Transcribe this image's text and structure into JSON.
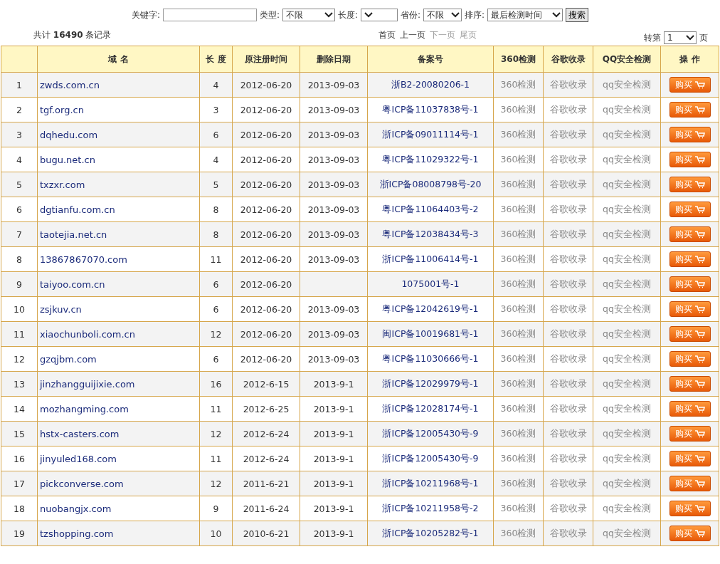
{
  "filters": {
    "keyword_label": "关键字:",
    "type_label": "类型:",
    "type_value": "不限",
    "length_label": "长度:",
    "province_label": "省份:",
    "province_value": "不限",
    "sort_label": "排序:",
    "sort_value": "最后检测时间",
    "search_button": "搜索"
  },
  "summary": {
    "prefix": "共计",
    "count": "16490",
    "suffix": "条记录"
  },
  "pager": [
    {
      "label": "首页",
      "disabled": false
    },
    {
      "label": "上一页",
      "disabled": false
    },
    {
      "label": "下一页",
      "disabled": true
    },
    {
      "label": "尾页",
      "disabled": true
    }
  ],
  "jump": {
    "prefix": "转第",
    "value": "1",
    "suffix": "页"
  },
  "table": {
    "columns": [
      "",
      "域 名",
      "长 度",
      "原注册时间",
      "删除日期",
      "备案号",
      "360检测",
      "谷歌收录",
      "QQ安全检测",
      "操 作"
    ],
    "rows": [
      {
        "no": "1",
        "domain": "zwds.com.cn",
        "length": "4",
        "registered": "2012-06-20",
        "deleted": "2013-09-03",
        "icp": "浙B2-20080206-1",
        "check360": "360检测",
        "google": "谷歌收录",
        "qq": "qq安全检测",
        "buy": "购买"
      },
      {
        "no": "2",
        "domain": "tgf.org.cn",
        "length": "3",
        "registered": "2012-06-20",
        "deleted": "2013-09-03",
        "icp": "粤ICP备11037838号-1",
        "check360": "360检测",
        "google": "谷歌收录",
        "qq": "qq安全检测",
        "buy": "购买"
      },
      {
        "no": "3",
        "domain": "dqhedu.com",
        "length": "6",
        "registered": "2012-06-20",
        "deleted": "2013-09-03",
        "icp": "浙ICP备09011114号-1",
        "check360": "360检测",
        "google": "谷歌收录",
        "qq": "qq安全检测",
        "buy": "购买"
      },
      {
        "no": "4",
        "domain": "bugu.net.cn",
        "length": "4",
        "registered": "2012-06-20",
        "deleted": "2013-09-03",
        "icp": "粤ICP备11029322号-1",
        "check360": "360检测",
        "google": "谷歌收录",
        "qq": "qq安全检测",
        "buy": "购买"
      },
      {
        "no": "5",
        "domain": "txzxr.com",
        "length": "5",
        "registered": "2012-06-20",
        "deleted": "2013-09-03",
        "icp": "浙ICP备08008798号-20",
        "check360": "360检测",
        "google": "谷歌收录",
        "qq": "qq安全检测",
        "buy": "购买"
      },
      {
        "no": "6",
        "domain": "dgtianfu.com.cn",
        "length": "8",
        "registered": "2012-06-20",
        "deleted": "2013-09-03",
        "icp": "粤ICP备11064403号-2",
        "check360": "360检测",
        "google": "谷歌收录",
        "qq": "qq安全检测",
        "buy": "购买"
      },
      {
        "no": "7",
        "domain": "taotejia.net.cn",
        "length": "8",
        "registered": "2012-06-20",
        "deleted": "2013-09-03",
        "icp": "粤ICP备12038434号-3",
        "check360": "360检测",
        "google": "谷歌收录",
        "qq": "qq安全检测",
        "buy": "购买"
      },
      {
        "no": "8",
        "domain": "13867867070.com",
        "length": "11",
        "registered": "2012-06-20",
        "deleted": "2013-09-03",
        "icp": "浙ICP备11006414号-1",
        "check360": "360检测",
        "google": "谷歌收录",
        "qq": "qq安全检测",
        "buy": "购买"
      },
      {
        "no": "9",
        "domain": "taiyoo.com.cn",
        "length": "6",
        "registered": "2012-06-20",
        "icp": "1075001号-1",
        "check360": "360检测",
        "google": "谷歌收录",
        "qq": "qq安全检测",
        "buy": "购买"
      },
      {
        "no": "10",
        "domain": "zsjkuv.cn",
        "length": "6",
        "registered": "2012-06-20",
        "deleted": "2013-09-03",
        "icp": "粤ICP备12042619号-1",
        "check360": "360检测",
        "google": "谷歌收录",
        "qq": "qq安全检测",
        "buy": "购买"
      },
      {
        "no": "11",
        "domain": "xiaochunboli.com.cn",
        "length": "12",
        "registered": "2012-06-20",
        "deleted": "2013-09-03",
        "icp": "闽ICP备10019681号-1",
        "check360": "360检测",
        "google": "谷歌收录",
        "qq": "qq安全检测",
        "buy": "购买"
      },
      {
        "no": "12",
        "domain": "gzqjbm.com",
        "length": "6",
        "registered": "2012-06-20",
        "deleted": "2013-09-03",
        "icp": "粤ICP备11030666号-1",
        "check360": "360检测",
        "google": "谷歌收录",
        "qq": "qq安全检测",
        "buy": "购买"
      },
      {
        "no": "13",
        "domain": "jinzhangguijixie.com",
        "length": "16",
        "registered": "2012-6-15",
        "deleted": "2013-9-1",
        "icp": "浙ICP备12029979号-1",
        "check360": "360检测",
        "google": "谷歌收录",
        "qq": "qq安全检测",
        "buy": "购买"
      },
      {
        "no": "14",
        "domain": "mozhangming.com",
        "length": "11",
        "registered": "2012-6-25",
        "deleted": "2013-9-1",
        "icp": "浙ICP备12028174号-1",
        "check360": "360检测",
        "google": "谷歌收录",
        "qq": "qq安全检测",
        "buy": "购买"
      },
      {
        "no": "15",
        "domain": "hstx-casters.com",
        "length": "12",
        "registered": "2012-6-24",
        "deleted": "2013-9-1",
        "icp": "浙ICP备12005430号-9",
        "check360": "360检测",
        "google": "谷歌收录",
        "qq": "qq安全检测",
        "buy": "购买"
      },
      {
        "no": "16",
        "domain": "jinyuled168.com",
        "length": "11",
        "registered": "2012-6-24",
        "deleted": "2013-9-1",
        "icp": "浙ICP备12005430号-9",
        "check360": "360检测",
        "google": "谷歌收录",
        "qq": "qq安全检测",
        "buy": "购买"
      },
      {
        "no": "17",
        "domain": "pickconverse.com",
        "length": "12",
        "registered": "2011-6-21",
        "deleted": "2013-9-1",
        "icp": "浙ICP备10211968号-1",
        "check360": "360检测",
        "google": "谷歌收录",
        "qq": "qq安全检测",
        "buy": "购买"
      },
      {
        "no": "18",
        "domain": "nuobangjx.com",
        "length": "9",
        "registered": "2011-6-24",
        "deleted": "2013-9-1",
        "icp": "浙ICP备10211958号-2",
        "check360": "360检测",
        "google": "谷歌收录",
        "qq": "qq安全检测",
        "buy": "购买"
      },
      {
        "no": "19",
        "domain": "tzshopping.com",
        "length": "10",
        "registered": "2010-6-21",
        "deleted": "2013-9-1",
        "icp": "浙ICP备10205282号-1",
        "check360": "360检测",
        "google": "谷歌收录",
        "qq": "qq安全检测",
        "buy": "购买"
      }
    ]
  }
}
